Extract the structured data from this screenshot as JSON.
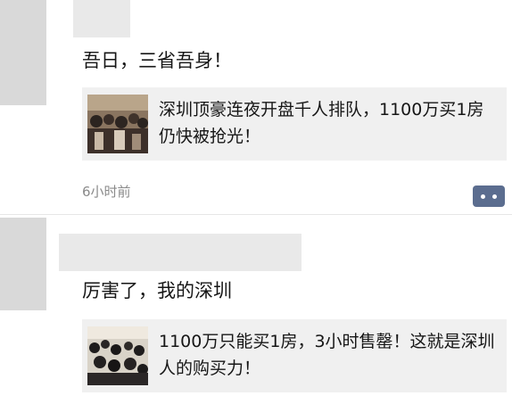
{
  "post1": {
    "text": "吾日，三省吾身！",
    "share": {
      "title": "深圳顶豪连夜开盘千人排队，1100万买1房仍快被抢光！"
    },
    "time": "6小时前"
  },
  "post2": {
    "text": "厉害了，我的深圳",
    "share": {
      "title": "1100万只能买1房，3小时售罄！这就是深圳人的购买力！"
    }
  },
  "icons": {
    "comment": "comment-more-icon"
  },
  "colors": {
    "comment_button": "#5b6d8f",
    "card_bg": "#f0f0f0",
    "time": "#8a8a8a"
  }
}
